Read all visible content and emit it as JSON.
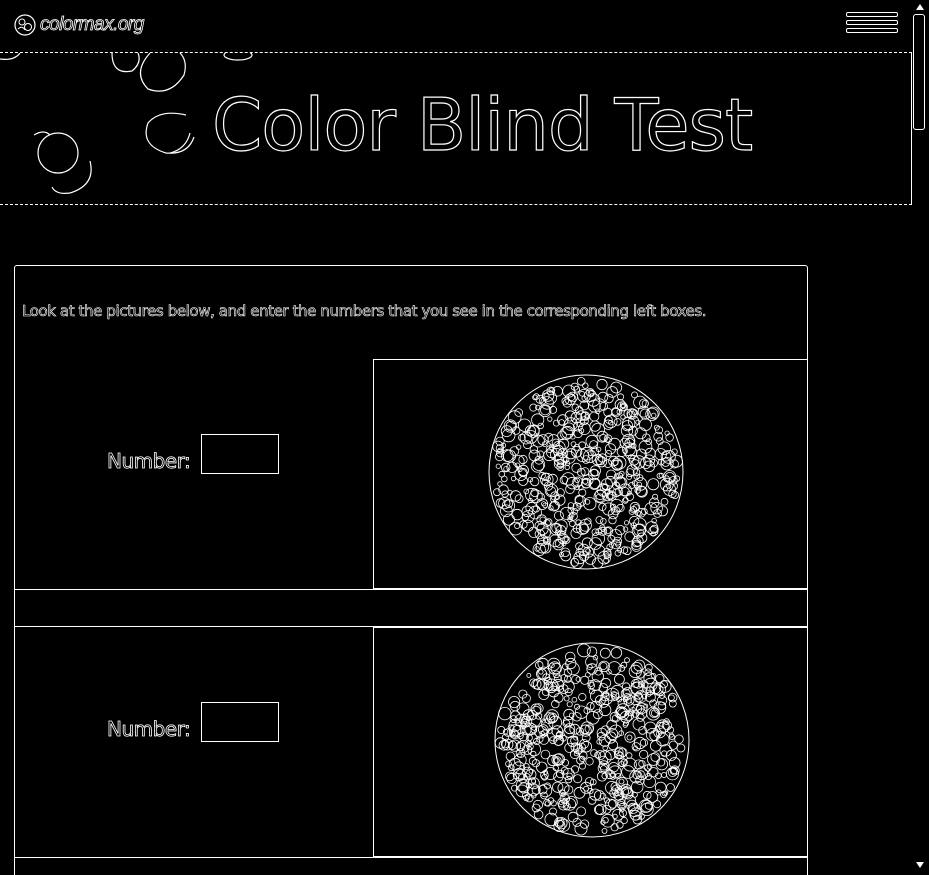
{
  "site": {
    "logo_text": "colormax.org",
    "logo_icon": "colormax-logo-icon",
    "menu_icon": "hamburger-menu-icon"
  },
  "banner": {
    "title": "Color Blind Test"
  },
  "test": {
    "instructions": "Look at the pictures below, and enter the numbers that you see in the corresponding left boxes.",
    "plates": [
      {
        "label": "Number:",
        "value": "",
        "image_icon": "ishihara-plate-icon"
      },
      {
        "label": "Number:",
        "value": "",
        "image_icon": "ishihara-plate-icon"
      }
    ]
  },
  "colors": {
    "background": "#000000",
    "foreground": "#ffffff"
  }
}
